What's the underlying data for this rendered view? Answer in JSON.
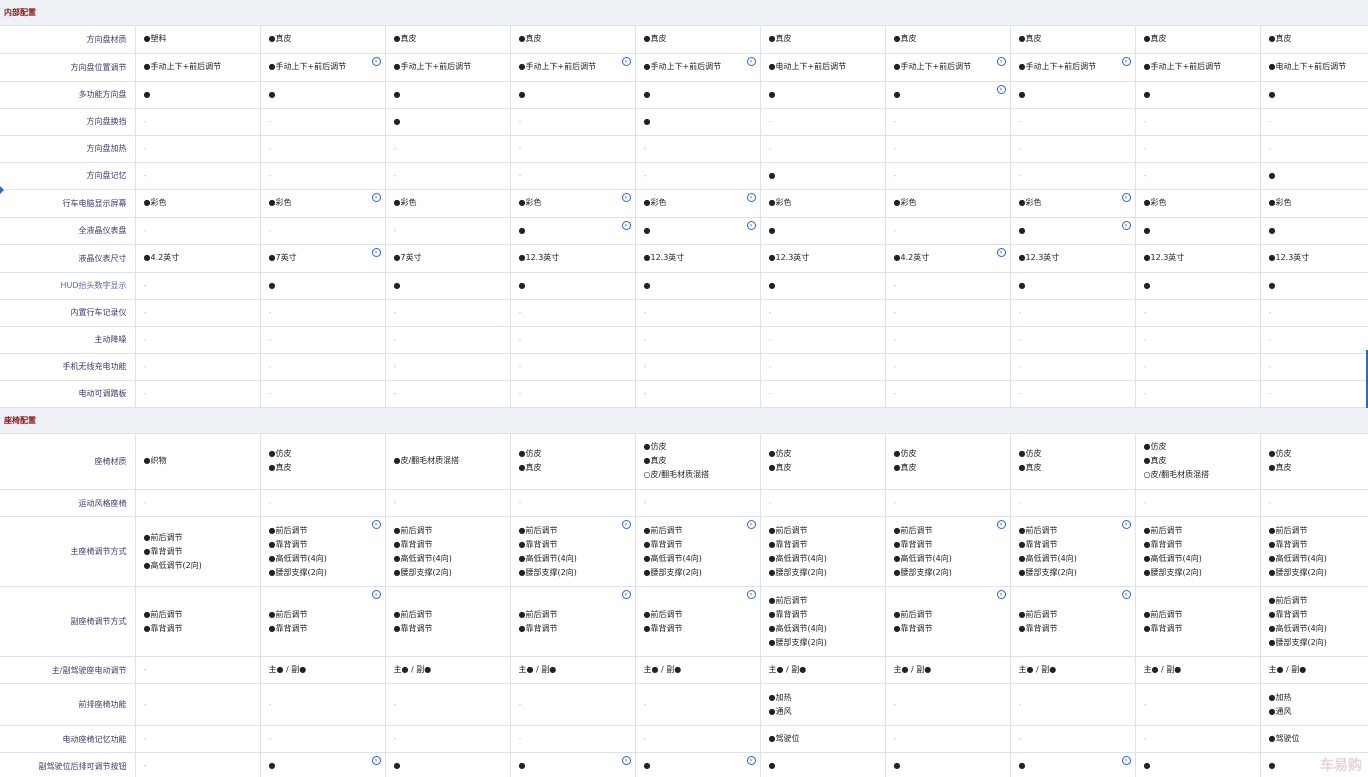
{
  "sections": [
    {
      "title": "内部配置",
      "rows": [
        {
          "label": "方向盘材质",
          "h": 27,
          "cells": [
            [
              "●塑料"
            ],
            [
              "●真皮"
            ],
            [
              "●真皮"
            ],
            [
              "●真皮"
            ],
            [
              "●真皮"
            ],
            [
              "●真皮"
            ],
            [
              "●真皮"
            ],
            [
              "●真皮"
            ],
            [
              "●真皮"
            ],
            [
              "●真皮"
            ]
          ]
        },
        {
          "label": "方向盘位置调节",
          "h": 28,
          "info": [
            1,
            3,
            4,
            6,
            7
          ],
          "cells": [
            [
              "●手动上下+前后调节"
            ],
            [
              "●手动上下+前后调节"
            ],
            [
              "●手动上下+前后调节"
            ],
            [
              "●手动上下+前后调节"
            ],
            [
              "●手动上下+前后调节"
            ],
            [
              "●电动上下+前后调节"
            ],
            [
              "●手动上下+前后调节"
            ],
            [
              "●手动上下+前后调节"
            ],
            [
              "●手动上下+前后调节"
            ],
            [
              "●电动上下+前后调节"
            ]
          ]
        },
        {
          "label": "多功能方向盘",
          "h": 27,
          "info": [
            6
          ],
          "cells": [
            [
              "●"
            ],
            [
              "●"
            ],
            [
              "●"
            ],
            [
              "●"
            ],
            [
              "●"
            ],
            [
              "●"
            ],
            [
              "●"
            ],
            [
              "●"
            ],
            [
              "●"
            ],
            [
              "●"
            ]
          ]
        },
        {
          "label": "方向盘换挡",
          "h": 27,
          "cells": [
            [
              "-"
            ],
            [
              "-"
            ],
            [
              "●"
            ],
            [
              "-"
            ],
            [
              "●"
            ],
            [
              "-"
            ],
            [
              "-"
            ],
            [
              "-"
            ],
            [
              "-"
            ],
            [
              "-"
            ]
          ]
        },
        {
          "label": "方向盘加热",
          "h": 27,
          "cells": [
            [
              "-"
            ],
            [
              "-"
            ],
            [
              "-"
            ],
            [
              "-"
            ],
            [
              "-"
            ],
            [
              "-"
            ],
            [
              "-"
            ],
            [
              "-"
            ],
            [
              "-"
            ],
            [
              "-"
            ]
          ]
        },
        {
          "label": "方向盘记忆",
          "h": 27,
          "cells": [
            [
              "-"
            ],
            [
              "-"
            ],
            [
              "-"
            ],
            [
              "-"
            ],
            [
              "-"
            ],
            [
              "●"
            ],
            [
              "-"
            ],
            [
              "-"
            ],
            [
              "-"
            ],
            [
              "●"
            ]
          ]
        },
        {
          "label": "行车电脑显示屏幕",
          "h": 28,
          "info": [
            1,
            3,
            4,
            7
          ],
          "cells": [
            [
              "●彩色"
            ],
            [
              "●彩色"
            ],
            [
              "●彩色"
            ],
            [
              "●彩色"
            ],
            [
              "●彩色"
            ],
            [
              "●彩色"
            ],
            [
              "●彩色"
            ],
            [
              "●彩色"
            ],
            [
              "●彩色"
            ],
            [
              "●彩色"
            ]
          ]
        },
        {
          "label": "全液晶仪表盘",
          "h": 27,
          "info": [
            3,
            4,
            7
          ],
          "cells": [
            [
              "-"
            ],
            [
              "-"
            ],
            [
              "-"
            ],
            [
              "●"
            ],
            [
              "●"
            ],
            [
              "●"
            ],
            [
              "-"
            ],
            [
              "●"
            ],
            [
              "●"
            ],
            [
              "●"
            ]
          ]
        },
        {
          "label": "液晶仪表尺寸",
          "h": 28,
          "info": [
            1,
            6
          ],
          "cells": [
            [
              "●4.2英寸"
            ],
            [
              "●7英寸"
            ],
            [
              "●7英寸"
            ],
            [
              "●12.3英寸"
            ],
            [
              "●12.3英寸"
            ],
            [
              "●12.3英寸"
            ],
            [
              "●4.2英寸"
            ],
            [
              "●12.3英寸"
            ],
            [
              "●12.3英寸"
            ],
            [
              "●12.3英寸"
            ]
          ]
        },
        {
          "label": "HUD抬头数字显示",
          "h": 27,
          "blue": true,
          "cells": [
            [
              "-"
            ],
            [
              "●"
            ],
            [
              "●"
            ],
            [
              "●"
            ],
            [
              "●"
            ],
            [
              "●"
            ],
            [
              "-"
            ],
            [
              "●"
            ],
            [
              "●"
            ],
            [
              "●"
            ]
          ]
        },
        {
          "label": "内置行车记录仪",
          "h": 27,
          "cells": [
            [
              "-"
            ],
            [
              "-"
            ],
            [
              "-"
            ],
            [
              "-"
            ],
            [
              "-"
            ],
            [
              "-"
            ],
            [
              "-"
            ],
            [
              "-"
            ],
            [
              "-"
            ],
            [
              "-"
            ]
          ]
        },
        {
          "label": "主动降噪",
          "h": 27,
          "cells": [
            [
              "-"
            ],
            [
              "-"
            ],
            [
              "-"
            ],
            [
              "-"
            ],
            [
              "-"
            ],
            [
              "-"
            ],
            [
              "-"
            ],
            [
              "-"
            ],
            [
              "-"
            ],
            [
              "-"
            ]
          ]
        },
        {
          "label": "手机无线充电功能",
          "h": 27,
          "cells": [
            [
              "-"
            ],
            [
              "-"
            ],
            [
              "-"
            ],
            [
              "-"
            ],
            [
              "-"
            ],
            [
              "-"
            ],
            [
              "-"
            ],
            [
              "-"
            ],
            [
              "-"
            ],
            [
              "-"
            ]
          ]
        },
        {
          "label": "电动可调踏板",
          "h": 27,
          "cells": [
            [
              "-"
            ],
            [
              "-"
            ],
            [
              "-"
            ],
            [
              "-"
            ],
            [
              "-"
            ],
            [
              "-"
            ],
            [
              "-"
            ],
            [
              "-"
            ],
            [
              "-"
            ],
            [
              "-"
            ]
          ]
        }
      ]
    },
    {
      "title": "座椅配置",
      "rows": [
        {
          "label": "座椅材质",
          "h": 56,
          "cells": [
            [
              "●织物"
            ],
            [
              "●仿皮",
              "●真皮"
            ],
            [
              "●皮/翻毛材质混搭"
            ],
            [
              "●仿皮",
              "●真皮"
            ],
            [
              "●仿皮",
              "●真皮",
              "○皮/翻毛材质混搭"
            ],
            [
              "●仿皮",
              "●真皮"
            ],
            [
              "●仿皮",
              "●真皮"
            ],
            [
              "●仿皮",
              "●真皮"
            ],
            [
              "●仿皮",
              "●真皮",
              "○皮/翻毛材质混搭"
            ],
            [
              "●仿皮",
              "●真皮"
            ]
          ]
        },
        {
          "label": "运动风格座椅",
          "h": 27,
          "cells": [
            [
              "-"
            ],
            [
              "-"
            ],
            [
              "-"
            ],
            [
              "-"
            ],
            [
              "-"
            ],
            [
              "-"
            ],
            [
              "-"
            ],
            [
              "-"
            ],
            [
              "-"
            ],
            [
              "-"
            ]
          ]
        },
        {
          "label": "主座椅调节方式",
          "h": 70,
          "info": [
            1,
            3,
            4,
            6,
            7
          ],
          "cells": [
            [
              "●前后调节",
              "●靠背调节",
              "●高低调节(2向)"
            ],
            [
              "●前后调节",
              "●靠背调节",
              "●高低调节(4向)",
              "●腰部支撑(2向)"
            ],
            [
              "●前后调节",
              "●靠背调节",
              "●高低调节(4向)",
              "●腰部支撑(2向)"
            ],
            [
              "●前后调节",
              "●靠背调节",
              "●高低调节(4向)",
              "●腰部支撑(2向)"
            ],
            [
              "●前后调节",
              "●靠背调节",
              "●高低调节(4向)",
              "●腰部支撑(2向)"
            ],
            [
              "●前后调节",
              "●靠背调节",
              "●高低调节(4向)",
              "●腰部支撑(2向)"
            ],
            [
              "●前后调节",
              "●靠背调节",
              "●高低调节(4向)",
              "●腰部支撑(2向)"
            ],
            [
              "●前后调节",
              "●靠背调节",
              "●高低调节(4向)",
              "●腰部支撑(2向)"
            ],
            [
              "●前后调节",
              "●靠背调节",
              "●高低调节(4向)",
              "●腰部支撑(2向)"
            ],
            [
              "●前后调节",
              "●靠背调节",
              "●高低调节(4向)",
              "●腰部支撑(2向)"
            ]
          ]
        },
        {
          "label": "副座椅调节方式",
          "h": 70,
          "info": [
            1,
            3,
            4,
            6,
            7
          ],
          "cells": [
            [
              "●前后调节",
              "●靠背调节"
            ],
            [
              "●前后调节",
              "●靠背调节"
            ],
            [
              "●前后调节",
              "●靠背调节"
            ],
            [
              "●前后调节",
              "●靠背调节"
            ],
            [
              "●前后调节",
              "●靠背调节"
            ],
            [
              "●前后调节",
              "●靠背调节",
              "●高低调节(4向)",
              "●腰部支撑(2向)"
            ],
            [
              "●前后调节",
              "●靠背调节"
            ],
            [
              "●前后调节",
              "●靠背调节"
            ],
            [
              "●前后调节",
              "●靠背调节"
            ],
            [
              "●前后调节",
              "●靠背调节",
              "●高低调节(4向)",
              "●腰部支撑(2向)"
            ]
          ]
        },
        {
          "label": "主/副驾驶座电动调节",
          "h": 27,
          "cells": [
            [
              "-"
            ],
            [
              "主● / 副●"
            ],
            [
              "主● / 副●"
            ],
            [
              "主● / 副●"
            ],
            [
              "主● / 副●"
            ],
            [
              "主● / 副●"
            ],
            [
              "主● / 副●"
            ],
            [
              "主● / 副●"
            ],
            [
              "主● / 副●"
            ],
            [
              "主● / 副●"
            ]
          ]
        },
        {
          "label": "前排座椅功能",
          "h": 42,
          "cells": [
            [
              "-"
            ],
            [
              "-"
            ],
            [
              "-"
            ],
            [
              "-"
            ],
            [
              "-"
            ],
            [
              "●加热",
              "●通风"
            ],
            [
              "-"
            ],
            [
              "-"
            ],
            [
              "-"
            ],
            [
              "●加热",
              "●通风"
            ]
          ]
        },
        {
          "label": "电动座椅记忆功能",
          "h": 27,
          "cells": [
            [
              "-"
            ],
            [
              "-"
            ],
            [
              "-"
            ],
            [
              "-"
            ],
            [
              "-"
            ],
            [
              "●驾驶位"
            ],
            [
              "-"
            ],
            [
              "-"
            ],
            [
              "-"
            ],
            [
              "●驾驶位"
            ]
          ]
        },
        {
          "label": "副驾驶位后排可调节按钮",
          "h": 27,
          "info": [
            1,
            3,
            4,
            7
          ],
          "cells": [
            [
              "-"
            ],
            [
              "●"
            ],
            [
              "●"
            ],
            [
              "●"
            ],
            [
              "●"
            ],
            [
              "●"
            ],
            [
              "●"
            ],
            [
              "●"
            ],
            [
              "●"
            ],
            [
              "●"
            ]
          ]
        }
      ]
    }
  ],
  "watermark": "车易购",
  "info_icon": "info-circle-icon"
}
